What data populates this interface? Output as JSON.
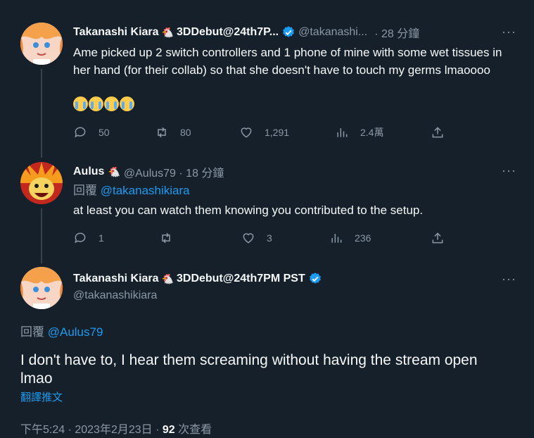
{
  "tweet1": {
    "name": "Takanashi Kiara",
    "name_suffix": "3DDebut@24th7P...",
    "handle": "@takanashi...",
    "time": "· 28 分鐘",
    "body": "Ame picked up 2 switch controllers and 1 phone of mine with some wet tissues in her hand (for their collab) so that she doesn't have to touch my germs lmaoooo",
    "emoji_count": 4,
    "replies": "50",
    "retweets": "80",
    "likes": "1,291",
    "views": "2.4萬"
  },
  "tweet2": {
    "name": "Aulus",
    "handle_time": "@Aulus79 · 18 分鐘",
    "reply_prefix": "回覆",
    "reply_to": "@takanashikiara",
    "body": "at least you can watch them knowing you contributed to the setup.",
    "replies": "1",
    "retweets": "",
    "likes": "3",
    "views": "236"
  },
  "tweet3": {
    "name": "Takanashi Kiara",
    "name_suffix": "3DDebut@24th7PM PST",
    "handle": "@takanashikiara",
    "reply_prefix": "回覆",
    "reply_to": "@Aulus79",
    "body": "I don't have to, I hear them screaming without having the stream open lmao",
    "translate": "翻譯推文",
    "timestamp": "下午5:24 · 2023年2月23日 · ",
    "view_count": "92",
    "view_label": " 次查看"
  },
  "more_glyph": "···",
  "chick_glyph": "🐔",
  "colors": {
    "background": "#15202b",
    "text": "#f7f9f9",
    "muted": "#8b98a5",
    "link": "#1d9bf0",
    "thread_line": "#38444d"
  }
}
